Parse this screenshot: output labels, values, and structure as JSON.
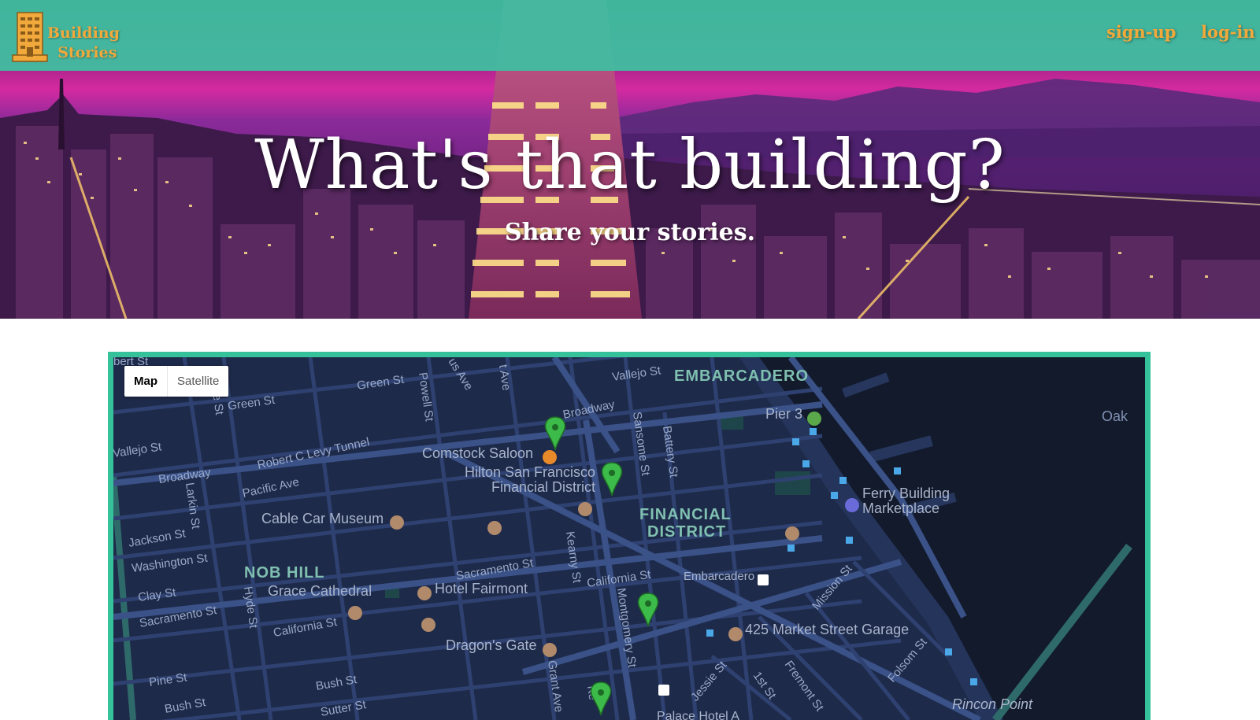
{
  "brand": {
    "line1": "Building",
    "line2": "Stories"
  },
  "nav": {
    "signup": "sign-up",
    "login": "log-in"
  },
  "hero": {
    "title": "What's that building?",
    "subtitle": "Share your stories."
  },
  "colors": {
    "navbar": "#40bea0",
    "accent": "#f2a93b",
    "map_border": "#35c19a",
    "map_bg": "#1e2a4a",
    "marker": "#3dbb4a"
  },
  "map": {
    "type_control": {
      "map_label": "Map",
      "satellite_label": "Satellite",
      "selected": "Map"
    },
    "districts": {
      "embarcadero": "EMBARCADERO",
      "financial_1": "FINANCIAL",
      "financial_2": "DISTRICT",
      "nob_hill": "NOB HILL"
    },
    "streets": {
      "vallejo_top": "Vallejo St",
      "green1": "Green St",
      "green2": "Green St",
      "powell": "Powell St",
      "columbus": "us Ave",
      "montgomery_ave": "t Ave",
      "broadway_top": "Broadway",
      "sansome": "Sansome St",
      "battery": "Battery St",
      "vallejo_left": "Vallejo St",
      "robert_c_levy": "Robert C Levy Tunnel",
      "broadway_left": "Broadway",
      "larkin": "Larkin St",
      "pacific": "Pacific Ave",
      "jackson": "Jackson St",
      "washington": "Washington St",
      "clay": "Clay St",
      "sacramento_left": "Sacramento St",
      "hyde": "Hyde St",
      "sacramento_mid": "Sacramento St",
      "california_mid": "California St",
      "california_right": "California St",
      "kearny": "Kearny St",
      "montgomery": "Montgomery St",
      "pine": "Pine St",
      "bush1": "Bush St",
      "bush2": "Bush St",
      "sutter": "Sutter St",
      "grant": "Grant Ave",
      "jessie": "Jessie St",
      "first": "1st St",
      "fremont": "Fremont St",
      "folsom": "Folsom St",
      "mission": "Mission St",
      "le_st": "le St",
      "bert": "bert St",
      "oak": "Oak",
      "kearny_short": "Ke"
    },
    "places": {
      "comstock": "Comstock Saloon",
      "hilton_1": "Hilton San Francisco",
      "hilton_2": "Financial District",
      "cable_car": "Cable Car Museum",
      "grace": "Grace Cathedral",
      "fairmont": "Hotel Fairmont",
      "dragons_gate": "Dragon's Gate",
      "embarcadero_station": "Embarcadero",
      "market_garage": "425 Market Street Garage",
      "pier3": "Pier 3",
      "ferry_1": "Ferry Building",
      "ferry_2": "Marketplace",
      "rincon": "Rincon Point",
      "palace": "Palace Hotel A"
    }
  }
}
